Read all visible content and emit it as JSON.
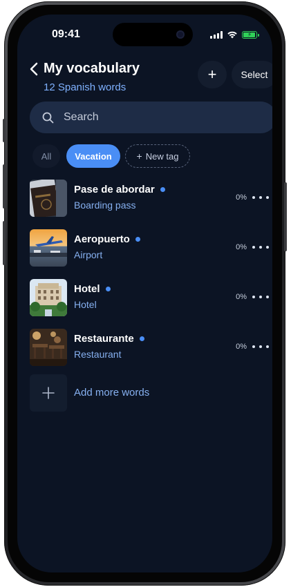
{
  "status_bar": {
    "time": "09:41",
    "battery_level": 0.85,
    "battery_color": "#30d158",
    "icons": [
      "signal-icon",
      "wifi-icon",
      "battery-charging-icon"
    ]
  },
  "header": {
    "back_icon": "chevron-left-icon",
    "title": "My vocabulary",
    "subtitle": "12 Spanish words",
    "add_icon": "plus-icon",
    "add_label": "+",
    "select_label": "Select"
  },
  "search": {
    "placeholder": "Search",
    "value": "",
    "icon": "search-icon"
  },
  "tags": {
    "all_label": "All",
    "active_label": "Vacation",
    "new_tag_label": "New tag",
    "accent": "#4a8ef5"
  },
  "words": [
    {
      "word": "Pase de abordar",
      "translation": "Boarding pass",
      "progress": "0%",
      "image": "passport-image"
    },
    {
      "word": "Aeropuerto",
      "translation": "Airport",
      "progress": "0%",
      "image": "airport-image"
    },
    {
      "word": "Hotel",
      "translation": "Hotel",
      "progress": "0%",
      "image": "hotel-image"
    },
    {
      "word": "Restaurante",
      "translation": "Restaurant",
      "progress": "0%",
      "image": "restaurant-image"
    }
  ],
  "add_more": {
    "label": "Add more words",
    "icon": "plus-icon"
  },
  "colors": {
    "background": "#0c1424",
    "accent": "#4a8ef5",
    "subtitle": "#7fb1ff"
  }
}
